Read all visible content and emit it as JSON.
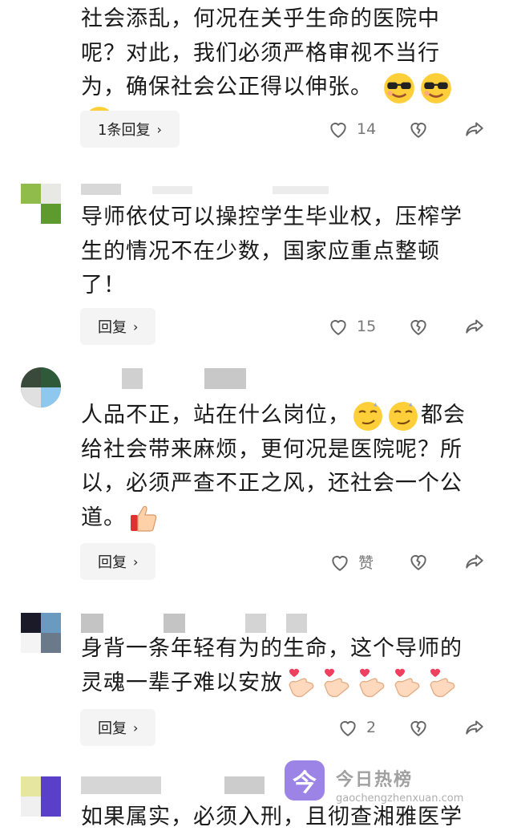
{
  "comments": [
    {
      "text_lines": [
        "社会添乱，何况在关乎生命的医院中",
        "呢？对此，我们必须严格审视不当行",
        "为，确保社会公正得以伸张。"
      ],
      "reply_label": "1条回复",
      "like_count": "14"
    },
    {
      "text_lines": [
        "导师依仗可以操控学生毕业权，压榨学",
        "生的情况不在少数，国家应重点整顿",
        "了！"
      ],
      "reply_label": "回复",
      "like_count": "15"
    },
    {
      "text_lines": [
        "人品不正，站在什么岗位，",
        "给社会带来麻烦，更何况是医院呢？所",
        "以，必须严查不正之风，还社会一个公",
        "道。"
      ],
      "text_tail": "都会",
      "reply_label": "回复",
      "like_count": "赞"
    },
    {
      "text_lines": [
        "身背一条年轻有为的生命，这个导师的",
        "灵魂一辈子难以安放"
      ],
      "reply_label": "回复",
      "like_count": "2"
    },
    {
      "text_lines": [
        "如果属实，必须入刑，且彻查湘雅医学"
      ]
    }
  ],
  "watermark": {
    "title": "今日热榜",
    "url": "gaochengzhenxuan.com",
    "icon_char": "今"
  },
  "colors": {
    "accent_watermark": "#8a6fe0",
    "heart_red": "#f04060"
  }
}
